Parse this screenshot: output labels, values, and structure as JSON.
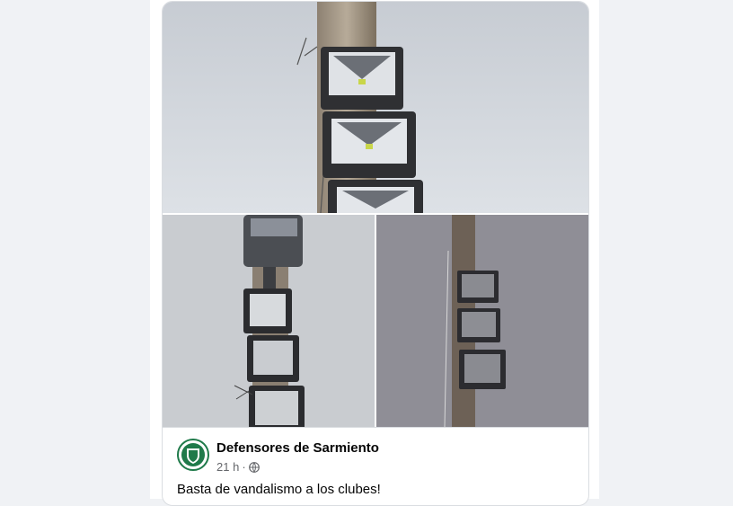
{
  "post": {
    "page_name": "Defensores de Sarmiento",
    "time": "21 h",
    "separator": "·",
    "visibility_icon": "globe-icon",
    "caption": "Basta de vandalismo a los clubes!"
  },
  "photos": [
    {
      "name": "photo-top",
      "subject": "floodlights on wooden pole"
    },
    {
      "name": "photo-bottom-left",
      "subject": "floodlights stack"
    },
    {
      "name": "photo-bottom-right",
      "subject": "floodlights on pole"
    }
  ],
  "colors": {
    "background": "#f0f2f5",
    "card": "#ffffff",
    "text_primary": "#050505",
    "text_secondary": "#65676b",
    "avatar_green": "#1f7a4a"
  }
}
